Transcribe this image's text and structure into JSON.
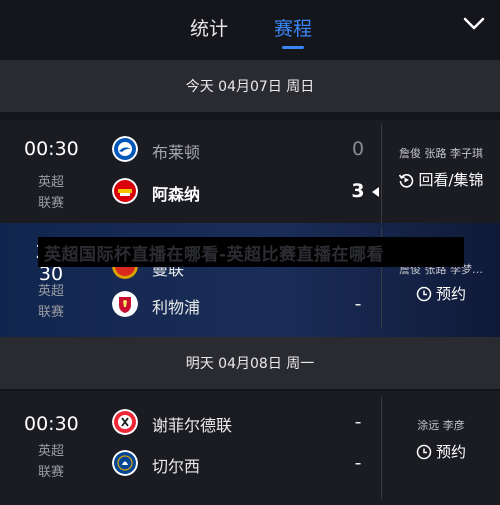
{
  "header": {
    "tabs": [
      {
        "label": "统计",
        "active": false
      },
      {
        "label": "赛程",
        "active": true
      }
    ],
    "accent_color": "#3a86f7"
  },
  "days": [
    {
      "date_label": "今天  04月07日 周日",
      "matches": [
        {
          "time": "00:30",
          "league_line1": "英超",
          "league_line2": "联赛",
          "home": {
            "name": "布莱顿",
            "score": "0",
            "badge": "brighton-badge"
          },
          "away": {
            "name": "阿森纳",
            "score": "3",
            "badge": "arsenal-badge"
          },
          "commentators": "詹俊 张路 李子琪",
          "action_label": "回看/集锦",
          "action_icon": "replay-icon"
        },
        {
          "time": "2…30",
          "league_line1": "英超",
          "league_line2": "联赛",
          "home": {
            "name": "曼联",
            "score": "",
            "badge": "manutd-badge"
          },
          "away": {
            "name": "利物浦",
            "score": "-",
            "badge": "liverpool-badge"
          },
          "commentators": "詹俊 张路 李梦…",
          "action_label": "预约",
          "action_icon": "clock-icon"
        }
      ]
    },
    {
      "date_label": "明天  04月08日 周一",
      "matches": [
        {
          "time": "00:30",
          "league_line1": "英超",
          "league_line2": "联赛",
          "home": {
            "name": "谢菲尔德联",
            "score": "-",
            "badge": "sheffield-badge"
          },
          "away": {
            "name": "切尔西",
            "score": "-",
            "badge": "chelsea-badge"
          },
          "commentators": "涂远 李彦",
          "action_label": "预约",
          "action_icon": "clock-icon"
        }
      ]
    }
  ],
  "overlay_banner": "英超国际杯直播在哪看-英超比赛直播在哪看"
}
